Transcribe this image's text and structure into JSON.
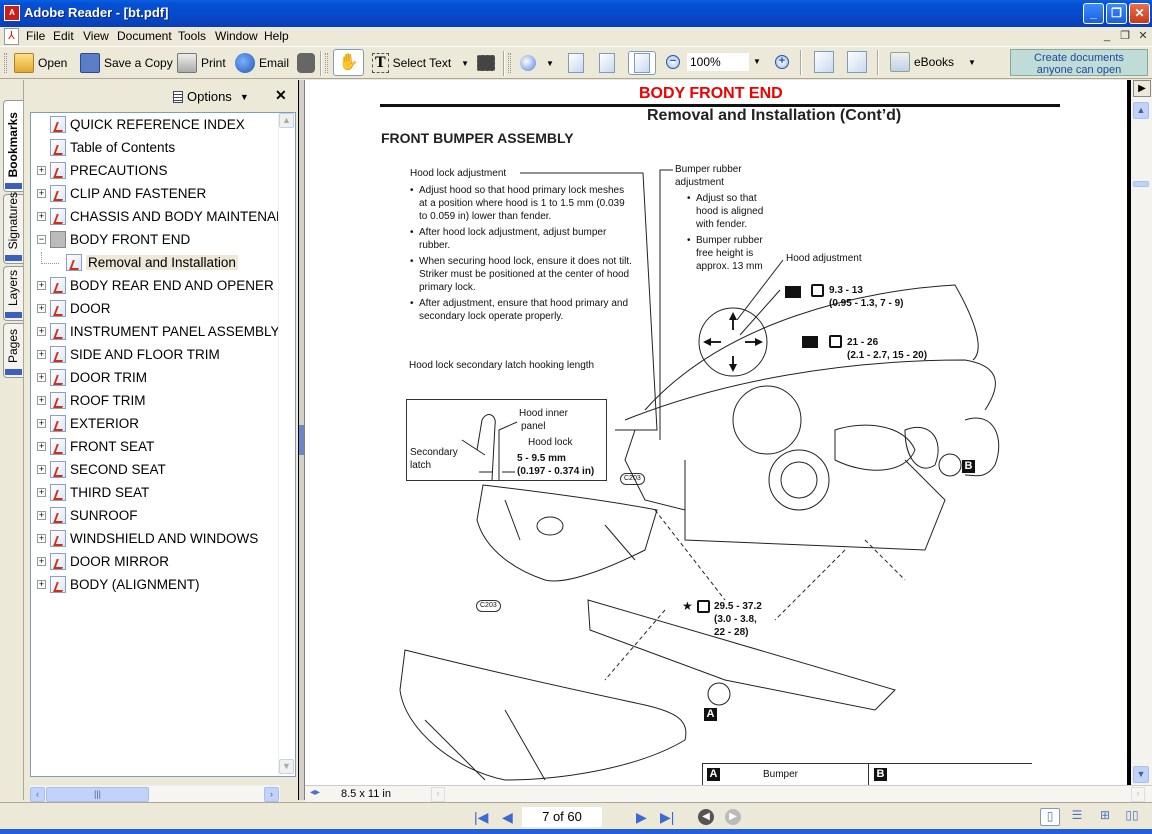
{
  "window": {
    "title": "Adobe Reader - [bt.pdf]",
    "controls": {
      "minimize": "_",
      "restore": "❐",
      "close": "✕"
    }
  },
  "menubar": {
    "items": [
      {
        "label": "File",
        "accel": "F"
      },
      {
        "label": "Edit",
        "accel": "E"
      },
      {
        "label": "View",
        "accel": "V"
      },
      {
        "label": "Document",
        "accel": "D"
      },
      {
        "label": "Tools",
        "accel": "T"
      },
      {
        "label": "Window",
        "accel": "W"
      },
      {
        "label": "Help",
        "accel": "H"
      }
    ],
    "doc_controls": {
      "minimize": "_",
      "restore": "❐",
      "close": "✕"
    }
  },
  "toolbar": {
    "open": "Open",
    "save_copy": "Save a Copy",
    "print": "Print",
    "email": "Email",
    "select_text": "Select Text",
    "zoom_value": "100%",
    "ebooks": "eBooks",
    "promo": "Create documents anyone can open",
    "promo_line1": "Create documents",
    "promo_line2": "anyone can open"
  },
  "side_tabs": [
    {
      "label": "Bookmarks",
      "active": true
    },
    {
      "label": "Signatures",
      "active": false
    },
    {
      "label": "Layers",
      "active": false
    },
    {
      "label": "Pages",
      "active": false
    }
  ],
  "bookmarks_panel": {
    "options_label": "Options",
    "items": [
      {
        "label": "QUICK REFERENCE INDEX",
        "expandable": false,
        "level": 0
      },
      {
        "label": "Table of Contents",
        "expandable": false,
        "level": 0
      },
      {
        "label": "PRECAUTIONS",
        "expandable": true,
        "expanded": false,
        "level": 0
      },
      {
        "label": "CLIP AND FASTENER",
        "expandable": true,
        "expanded": false,
        "level": 0
      },
      {
        "label": "CHASSIS AND BODY MAINTENANCE",
        "expandable": true,
        "expanded": false,
        "level": 0
      },
      {
        "label": "BODY FRONT END",
        "expandable": true,
        "expanded": true,
        "level": 0
      },
      {
        "label": "Removal and Installation",
        "expandable": false,
        "level": 1,
        "selected": true
      },
      {
        "label": "BODY REAR END AND OPENER",
        "expandable": true,
        "expanded": false,
        "level": 0
      },
      {
        "label": "DOOR",
        "expandable": true,
        "expanded": false,
        "level": 0
      },
      {
        "label": "INSTRUMENT PANEL ASSEMBLY",
        "expandable": true,
        "expanded": false,
        "level": 0
      },
      {
        "label": "SIDE AND FLOOR TRIM",
        "expandable": true,
        "expanded": false,
        "level": 0
      },
      {
        "label": "DOOR TRIM",
        "expandable": true,
        "expanded": false,
        "level": 0
      },
      {
        "label": "ROOF TRIM",
        "expandable": true,
        "expanded": false,
        "level": 0
      },
      {
        "label": "EXTERIOR",
        "expandable": true,
        "expanded": false,
        "level": 0
      },
      {
        "label": "FRONT SEAT",
        "expandable": true,
        "expanded": false,
        "level": 0
      },
      {
        "label": "SECOND SEAT",
        "expandable": true,
        "expanded": false,
        "level": 0
      },
      {
        "label": "THIRD SEAT",
        "expandable": true,
        "expanded": false,
        "level": 0
      },
      {
        "label": "SUNROOF",
        "expandable": true,
        "expanded": false,
        "level": 0
      },
      {
        "label": "WINDSHIELD AND WINDOWS",
        "expandable": true,
        "expanded": false,
        "level": 0
      },
      {
        "label": "DOOR MIRROR",
        "expandable": true,
        "expanded": false,
        "level": 0
      },
      {
        "label": "BODY (ALIGNMENT)",
        "expandable": true,
        "expanded": false,
        "level": 0
      }
    ]
  },
  "document": {
    "section_header": "BODY FRONT END",
    "subtitle": "Removal and Installation (Cont’d)",
    "heading": "FRONT BUMPER ASSEMBLY",
    "figure": {
      "hood_lock_title": "Hood lock adjustment",
      "hood_lock_bullets": [
        "Adjust hood so that hood primary lock meshes at a position where hood is 1 to 1.5 mm (0.039 to 0.059 in) lower than fender.",
        "After hood lock adjustment, adjust bumper rubber.",
        "When securing hood lock, ensure it does not tilt. Striker must be positioned at the center of hood primary lock.",
        "After adjustment, ensure that hood primary and secondary lock operate properly."
      ],
      "secondary_latch_label": "Hood lock secondary latch hooking length",
      "bumper_rubber_title": "Bumper rubber adjustment",
      "bumper_rubber_bullets": [
        "Adjust so that hood is aligned with fender.",
        "Bumper rubber free height is approx. 13 mm"
      ],
      "hood_adjustment": "Hood adjustment",
      "torque1_main": "9.3 - 13",
      "torque1_sub": "(0.95 - 1.3, 7 - 9)",
      "torque2_main": "21 - 26",
      "torque2_sub": "(2.1 - 2.7, 15 - 20)",
      "torque3_main": "29.5 - 37.2",
      "torque3_sub1": "(3.0 - 3.8,",
      "torque3_sub2": "22 - 28)",
      "star": "★",
      "inset_hood_inner": "Hood inner",
      "inset_panel": "panel",
      "inset_hood_lock": "Hood lock",
      "inset_secondary": "Secondary",
      "inset_latch": "latch",
      "inset_dim_mm": "5 - 9.5 mm",
      "inset_dim_in": "(0.197 - 0.374 in)",
      "clip_code": "C203",
      "label_a": "A",
      "label_b": "B",
      "box_bumper": "Bumper"
    }
  },
  "statusbar": {
    "page_size": "8.5 x 11 in",
    "page_indicator": "7 of 60"
  }
}
